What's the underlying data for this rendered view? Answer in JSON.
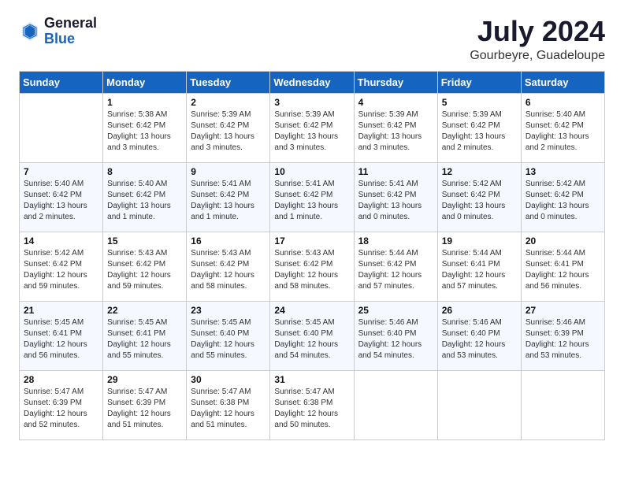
{
  "logo": {
    "general": "General",
    "blue": "Blue"
  },
  "title": "July 2024",
  "subtitle": "Gourbeyre, Guadeloupe",
  "columns": [
    "Sunday",
    "Monday",
    "Tuesday",
    "Wednesday",
    "Thursday",
    "Friday",
    "Saturday"
  ],
  "weeks": [
    [
      {
        "num": "",
        "info": ""
      },
      {
        "num": "1",
        "info": "Sunrise: 5:38 AM\nSunset: 6:42 PM\nDaylight: 13 hours\nand 3 minutes."
      },
      {
        "num": "2",
        "info": "Sunrise: 5:39 AM\nSunset: 6:42 PM\nDaylight: 13 hours\nand 3 minutes."
      },
      {
        "num": "3",
        "info": "Sunrise: 5:39 AM\nSunset: 6:42 PM\nDaylight: 13 hours\nand 3 minutes."
      },
      {
        "num": "4",
        "info": "Sunrise: 5:39 AM\nSunset: 6:42 PM\nDaylight: 13 hours\nand 3 minutes."
      },
      {
        "num": "5",
        "info": "Sunrise: 5:39 AM\nSunset: 6:42 PM\nDaylight: 13 hours\nand 2 minutes."
      },
      {
        "num": "6",
        "info": "Sunrise: 5:40 AM\nSunset: 6:42 PM\nDaylight: 13 hours\nand 2 minutes."
      }
    ],
    [
      {
        "num": "7",
        "info": "Sunrise: 5:40 AM\nSunset: 6:42 PM\nDaylight: 13 hours\nand 2 minutes."
      },
      {
        "num": "8",
        "info": "Sunrise: 5:40 AM\nSunset: 6:42 PM\nDaylight: 13 hours\nand 1 minute."
      },
      {
        "num": "9",
        "info": "Sunrise: 5:41 AM\nSunset: 6:42 PM\nDaylight: 13 hours\nand 1 minute."
      },
      {
        "num": "10",
        "info": "Sunrise: 5:41 AM\nSunset: 6:42 PM\nDaylight: 13 hours\nand 1 minute."
      },
      {
        "num": "11",
        "info": "Sunrise: 5:41 AM\nSunset: 6:42 PM\nDaylight: 13 hours\nand 0 minutes."
      },
      {
        "num": "12",
        "info": "Sunrise: 5:42 AM\nSunset: 6:42 PM\nDaylight: 13 hours\nand 0 minutes."
      },
      {
        "num": "13",
        "info": "Sunrise: 5:42 AM\nSunset: 6:42 PM\nDaylight: 13 hours\nand 0 minutes."
      }
    ],
    [
      {
        "num": "14",
        "info": "Sunrise: 5:42 AM\nSunset: 6:42 PM\nDaylight: 12 hours\nand 59 minutes."
      },
      {
        "num": "15",
        "info": "Sunrise: 5:43 AM\nSunset: 6:42 PM\nDaylight: 12 hours\nand 59 minutes."
      },
      {
        "num": "16",
        "info": "Sunrise: 5:43 AM\nSunset: 6:42 PM\nDaylight: 12 hours\nand 58 minutes."
      },
      {
        "num": "17",
        "info": "Sunrise: 5:43 AM\nSunset: 6:42 PM\nDaylight: 12 hours\nand 58 minutes."
      },
      {
        "num": "18",
        "info": "Sunrise: 5:44 AM\nSunset: 6:42 PM\nDaylight: 12 hours\nand 57 minutes."
      },
      {
        "num": "19",
        "info": "Sunrise: 5:44 AM\nSunset: 6:41 PM\nDaylight: 12 hours\nand 57 minutes."
      },
      {
        "num": "20",
        "info": "Sunrise: 5:44 AM\nSunset: 6:41 PM\nDaylight: 12 hours\nand 56 minutes."
      }
    ],
    [
      {
        "num": "21",
        "info": "Sunrise: 5:45 AM\nSunset: 6:41 PM\nDaylight: 12 hours\nand 56 minutes."
      },
      {
        "num": "22",
        "info": "Sunrise: 5:45 AM\nSunset: 6:41 PM\nDaylight: 12 hours\nand 55 minutes."
      },
      {
        "num": "23",
        "info": "Sunrise: 5:45 AM\nSunset: 6:40 PM\nDaylight: 12 hours\nand 55 minutes."
      },
      {
        "num": "24",
        "info": "Sunrise: 5:45 AM\nSunset: 6:40 PM\nDaylight: 12 hours\nand 54 minutes."
      },
      {
        "num": "25",
        "info": "Sunrise: 5:46 AM\nSunset: 6:40 PM\nDaylight: 12 hours\nand 54 minutes."
      },
      {
        "num": "26",
        "info": "Sunrise: 5:46 AM\nSunset: 6:40 PM\nDaylight: 12 hours\nand 53 minutes."
      },
      {
        "num": "27",
        "info": "Sunrise: 5:46 AM\nSunset: 6:39 PM\nDaylight: 12 hours\nand 53 minutes."
      }
    ],
    [
      {
        "num": "28",
        "info": "Sunrise: 5:47 AM\nSunset: 6:39 PM\nDaylight: 12 hours\nand 52 minutes."
      },
      {
        "num": "29",
        "info": "Sunrise: 5:47 AM\nSunset: 6:39 PM\nDaylight: 12 hours\nand 51 minutes."
      },
      {
        "num": "30",
        "info": "Sunrise: 5:47 AM\nSunset: 6:38 PM\nDaylight: 12 hours\nand 51 minutes."
      },
      {
        "num": "31",
        "info": "Sunrise: 5:47 AM\nSunset: 6:38 PM\nDaylight: 12 hours\nand 50 minutes."
      },
      {
        "num": "",
        "info": ""
      },
      {
        "num": "",
        "info": ""
      },
      {
        "num": "",
        "info": ""
      }
    ]
  ]
}
